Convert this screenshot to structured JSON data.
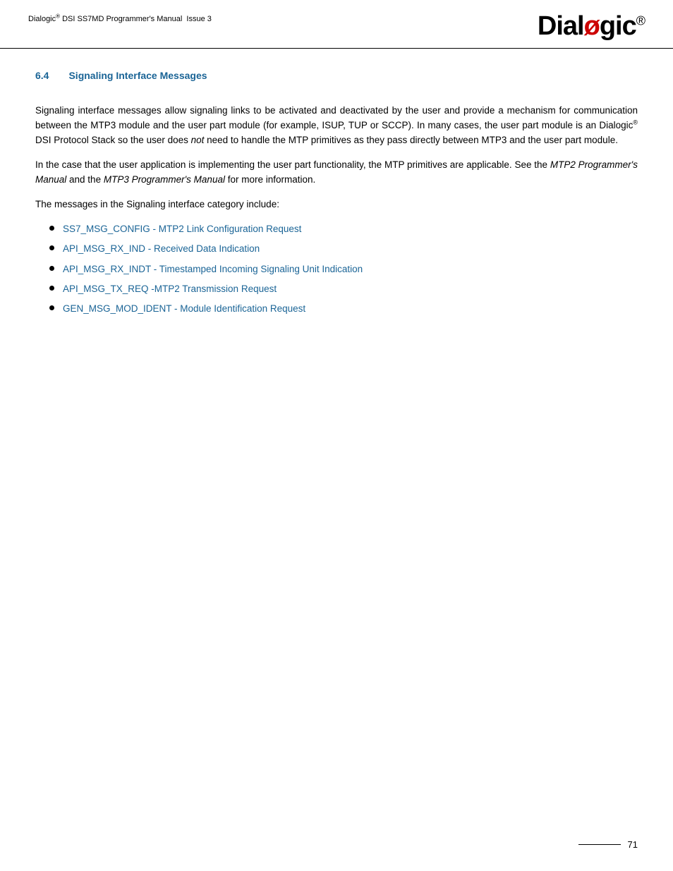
{
  "header": {
    "title": "Dialogic",
    "title_sup": "®",
    "title_rest": " DSI SS7MD Programmer's Manual  Issue 3"
  },
  "logo": {
    "part1": "Dial",
    "slash": "ø",
    "part2": "gic",
    "registered": "®"
  },
  "section": {
    "number": "6.4",
    "title": "Signaling Interface Messages"
  },
  "paragraphs": {
    "p1": "Signaling interface messages allow signaling links to be activated and deactivated by the user and provide a mechanism for communication between the MTP3 module and the user part module (for example, ISUP, TUP or SCCP). In many cases, the user part module is an Dialogic",
    "p1_sup": "®",
    "p1_rest": " DSI Protocol Stack so the user does ",
    "p1_em": "not",
    "p1_end": " need to handle the MTP primitives as they pass directly between MTP3 and the user part module.",
    "p2_start": "In the case that the user application is implementing the user part functionality, the MTP primitives are applicable. See the ",
    "p2_em1": "MTP2 Programmer's Manual",
    "p2_mid": " and the ",
    "p2_em2": "MTP3 Programmer's Manual",
    "p2_end": " for more information.",
    "p3": "The messages in the Signaling interface category include:"
  },
  "bullet_items": [
    {
      "link_part1": "SS7_MSG_CONFIG",
      "separator": " - ",
      "link_part2": "MTP2 Link Configuration Request"
    },
    {
      "link_part1": "API_MSG_RX_IND",
      "separator": " - ",
      "link_part2": "Received Data Indication"
    },
    {
      "link_part1": "API_MSG_RX_INDT",
      "separator": " - ",
      "link_part2": "Timestamped Incoming Signaling Unit Indication"
    },
    {
      "link_part1": "API_MSG_TX_REQ",
      "separator": " -",
      "link_part2": "MTP2 Transmission Request"
    },
    {
      "link_part1": "GEN_MSG_MOD_IDENT",
      "separator": " - ",
      "link_part2": "Module Identification Request"
    }
  ],
  "footer": {
    "page_number": "71"
  }
}
